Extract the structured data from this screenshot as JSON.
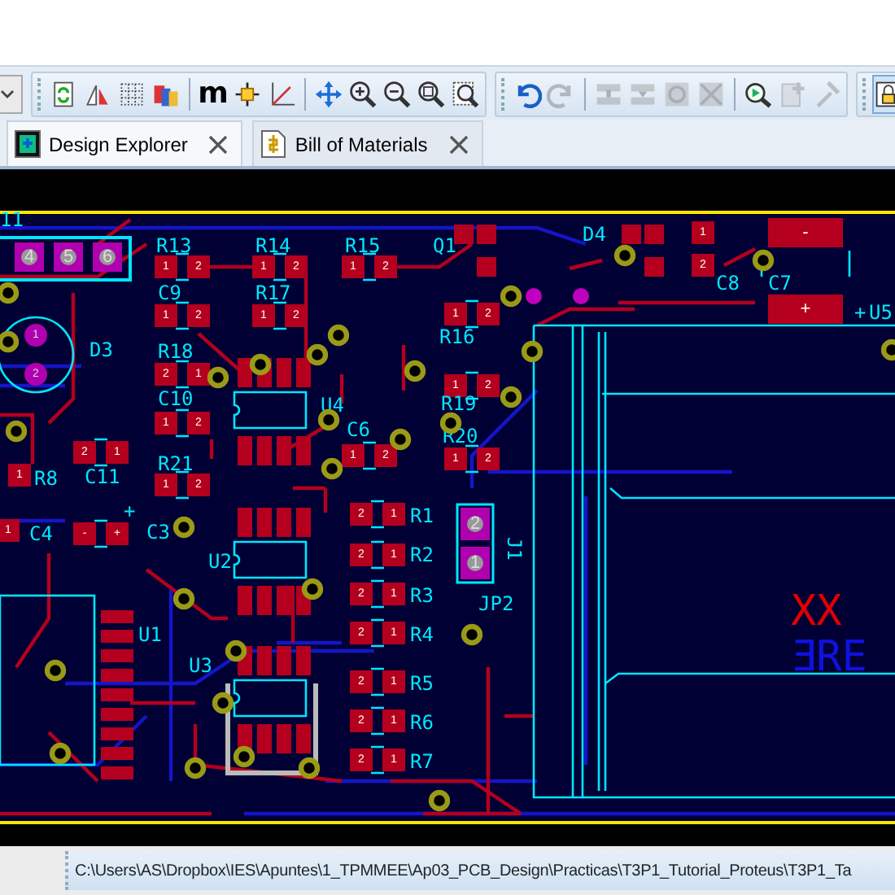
{
  "toolbar": {
    "groups": [
      {
        "sections": [
          [
            {
              "kind": "refresh",
              "disabled": false
            },
            {
              "kind": "flip",
              "disabled": false
            },
            {
              "kind": "grid",
              "disabled": false
            },
            {
              "kind": "layers",
              "disabled": false
            }
          ],
          [
            {
              "kind": "glyph",
              "label": "m",
              "disabled": false
            },
            {
              "kind": "origin",
              "disabled": false
            },
            {
              "kind": "axes",
              "disabled": false
            }
          ],
          [
            {
              "kind": "pan",
              "disabled": false
            },
            {
              "kind": "zoom-in",
              "disabled": false
            },
            {
              "kind": "zoom-out",
              "disabled": false
            },
            {
              "kind": "zoom-all",
              "disabled": false
            },
            {
              "kind": "zoom-area",
              "disabled": false
            }
          ]
        ]
      },
      {
        "sections": [
          [
            {
              "kind": "undo",
              "disabled": false
            },
            {
              "kind": "redo",
              "disabled": true
            }
          ],
          [
            {
              "kind": "block-copy",
              "disabled": true
            },
            {
              "kind": "block-move",
              "disabled": true
            },
            {
              "kind": "block-rotate",
              "disabled": true
            },
            {
              "kind": "block-delete",
              "disabled": true
            }
          ],
          [
            {
              "kind": "pick",
              "disabled": false
            },
            {
              "kind": "new-part",
              "disabled": true
            },
            {
              "kind": "hammer",
              "disabled": true
            }
          ]
        ]
      },
      {
        "sections": [
          [
            {
              "kind": "lock",
              "disabled": false
            }
          ]
        ]
      }
    ]
  },
  "tabs": [
    {
      "label": "Design Explorer",
      "selected": true,
      "kind": "explorer"
    },
    {
      "label": "Bill of Materials",
      "selected": false,
      "kind": "bom"
    }
  ],
  "board": {
    "components": [
      {
        "ref": "11",
        "kind": "header",
        "pads": [
          "4",
          "5",
          "6"
        ]
      },
      {
        "ref": "D3",
        "kind": "led",
        "pads": [
          "1",
          "2"
        ]
      },
      {
        "ref": "R13",
        "kind": "smd",
        "pads": [
          "1",
          "2"
        ]
      },
      {
        "ref": "R14",
        "kind": "smd",
        "pads": [
          "1",
          "2"
        ]
      },
      {
        "ref": "R15",
        "kind": "smd",
        "pads": [
          "1",
          "2"
        ]
      },
      {
        "ref": "C9",
        "kind": "smd",
        "pads": [
          "1",
          "2"
        ]
      },
      {
        "ref": "R17",
        "kind": "smd",
        "pads": [
          "1",
          "2"
        ]
      },
      {
        "ref": "R18",
        "kind": "smd",
        "pads": [
          "2",
          "1"
        ]
      },
      {
        "ref": "C10",
        "kind": "smd",
        "pads": [
          "1",
          "2"
        ]
      },
      {
        "ref": "R8",
        "kind": "smd",
        "pads": [
          "1"
        ]
      },
      {
        "ref": "C11",
        "kind": "smd",
        "pads": [
          "2",
          "1"
        ]
      },
      {
        "ref": "R21",
        "kind": "smd",
        "pads": [
          "1",
          "2"
        ]
      },
      {
        "ref": "C4",
        "kind": "smd",
        "pads": [
          "1"
        ]
      },
      {
        "ref": "C3",
        "kind": "smd",
        "pads": [
          "-",
          "+"
        ]
      },
      {
        "ref": "U4",
        "kind": "soic"
      },
      {
        "ref": "C6",
        "kind": "smd",
        "pads": [
          "1",
          "2"
        ]
      },
      {
        "ref": "U2",
        "kind": "soic"
      },
      {
        "ref": "U3",
        "kind": "soic"
      },
      {
        "ref": "U1",
        "kind": "dip"
      },
      {
        "ref": "R1",
        "kind": "smd",
        "pads": [
          "2",
          "1"
        ]
      },
      {
        "ref": "R2",
        "kind": "smd",
        "pads": [
          "2",
          "1"
        ]
      },
      {
        "ref": "R3",
        "kind": "smd",
        "pads": [
          "2",
          "1"
        ]
      },
      {
        "ref": "R4",
        "kind": "smd",
        "pads": [
          "2",
          "1"
        ]
      },
      {
        "ref": "R5",
        "kind": "smd",
        "pads": [
          "2",
          "1"
        ]
      },
      {
        "ref": "R6",
        "kind": "smd",
        "pads": [
          "2",
          "1"
        ]
      },
      {
        "ref": "R7",
        "kind": "smd",
        "pads": [
          "2",
          "1"
        ]
      },
      {
        "ref": "Q1",
        "kind": "sot"
      },
      {
        "ref": "R16",
        "kind": "smd",
        "pads": [
          "1",
          "2"
        ]
      },
      {
        "ref": "R19",
        "kind": "smd",
        "pads": [
          "1",
          "2"
        ]
      },
      {
        "ref": "R20",
        "kind": "smd",
        "pads": [
          "1",
          "2"
        ]
      },
      {
        "ref": "JP2",
        "kind": "jumper",
        "pads": [
          "2",
          "1"
        ]
      },
      {
        "ref": "J1",
        "kind": "module"
      },
      {
        "ref": "D4",
        "kind": "sot"
      },
      {
        "ref": "C8",
        "kind": "smd_v",
        "pads": [
          "1",
          "2"
        ]
      },
      {
        "ref": "C7",
        "kind": "pol_v",
        "pads": [
          "-",
          "+"
        ]
      },
      {
        "ref": "U5",
        "kind": "label"
      }
    ],
    "silk_texts": [
      {
        "text": "+",
        "kind": "top"
      },
      {
        "text": "+",
        "kind": "top"
      },
      {
        "text": "XX",
        "kind": "mark"
      },
      {
        "text": "ƎRE",
        "kind": "bottom"
      }
    ]
  },
  "status_bar": {
    "path": "C:\\Users\\AS\\Dropbox\\IES\\Apuntes\\1_TPMMEE\\Ap03_PCB_Design\\Practicas\\T3P1_Tutorial_Proteus\\T3P1_Ta"
  }
}
